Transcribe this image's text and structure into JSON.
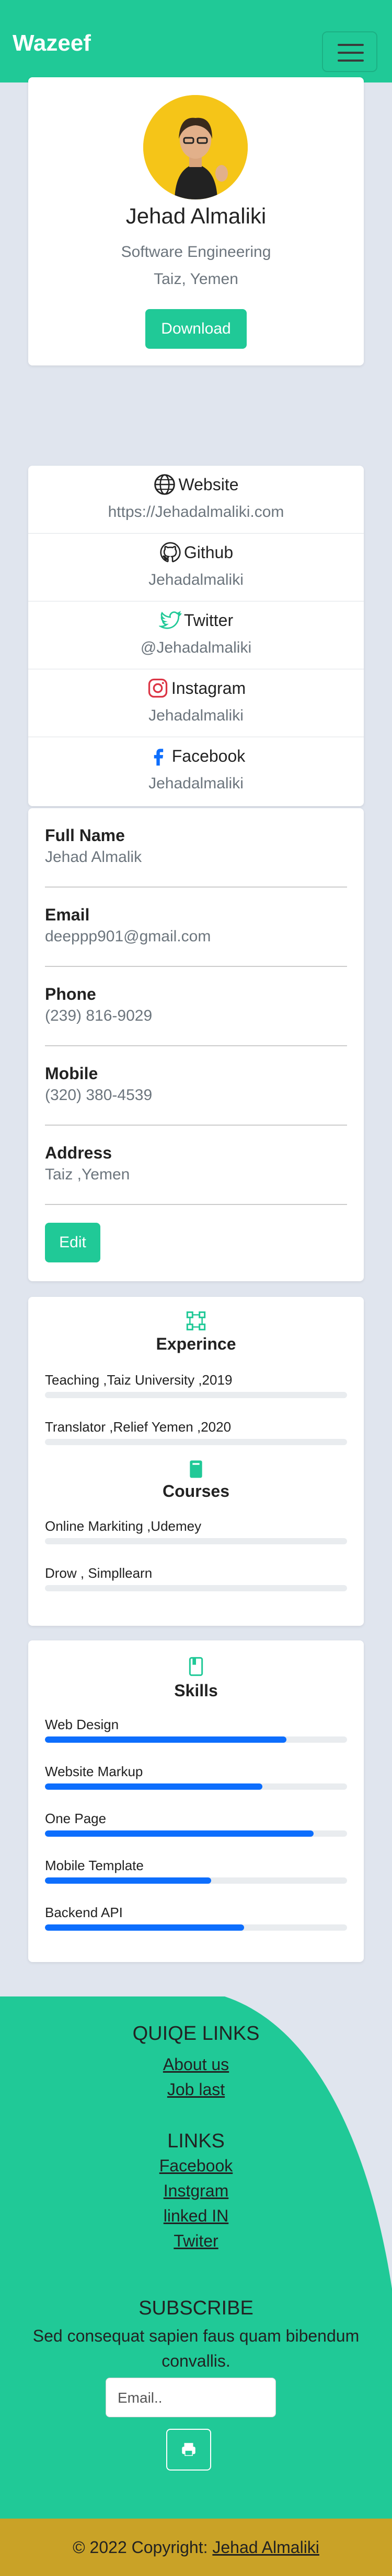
{
  "navbar": {
    "brand": "Wazeef",
    "toggler_icon": "hamburger-icon"
  },
  "profile": {
    "name": "Jehad Almaliki",
    "role": "Software Engineering",
    "location": "Taiz, Yemen",
    "download_label": "Download"
  },
  "social": [
    {
      "icon": "globe-icon",
      "title": "Website",
      "value": "https://Jehadalmaliki.com"
    },
    {
      "icon": "github-icon",
      "title": "Github",
      "value": "Jehadalmaliki"
    },
    {
      "icon": "twitter-icon",
      "title": "Twitter",
      "value": "@Jehadalmaliki"
    },
    {
      "icon": "instagram-icon",
      "title": "Instagram",
      "value": "Jehadalmaliki"
    },
    {
      "icon": "facebook-icon",
      "title": "Facebook",
      "value": "Jehadalmaliki"
    }
  ],
  "info": {
    "full_name_label": "Full Name",
    "full_name": "Jehad Almalik",
    "email_label": "Email",
    "email": "deeppp901@gmail.com",
    "phone_label": "Phone",
    "phone": "(239) 816-9029",
    "mobile_label": "Mobile",
    "mobile": "(320) 380-4539",
    "address_label": "Address",
    "address": "Taiz ,Yemen",
    "edit_label": "Edit"
  },
  "experience": {
    "title": "Experince",
    "items": [
      "Teaching ,Taiz University ,2019",
      "Translator ,Relief Yemen ,2020"
    ]
  },
  "courses": {
    "title": "Courses",
    "items": [
      "Online Markiting ,Udemey",
      "Drow , Simpllearn"
    ]
  },
  "skills": {
    "title": "Skills",
    "items": [
      {
        "label": "Web Design",
        "level": 0.8
      },
      {
        "label": "Website Markup",
        "level": 0.72
      },
      {
        "label": "One Page",
        "level": 0.89
      },
      {
        "label": "Mobile Template",
        "level": 0.55
      },
      {
        "label": "Backend API",
        "level": 0.66
      }
    ],
    "bar_color": "#0d6efd"
  },
  "footer": {
    "quick_title": "QUIQE LINKS",
    "quick_links": [
      "About us",
      "Job last"
    ],
    "links_title": "LINKS",
    "links": [
      "Facebook",
      "Instgram",
      "linked IN",
      "Twiter"
    ],
    "subscribe_title": "SUBSCRIBE",
    "subscribe_text": "Sed consequat sapien faus quam bibendum convallis.",
    "email_placeholder": "Email..",
    "send_icon": "send-icon"
  },
  "copyright": {
    "text": "© 2022 Copyright:",
    "link": "Jehad Almaliki"
  },
  "colors": {
    "accent": "#20c997",
    "footer_bar": "#c9a227",
    "page_bg": "#e0e5ee"
  }
}
